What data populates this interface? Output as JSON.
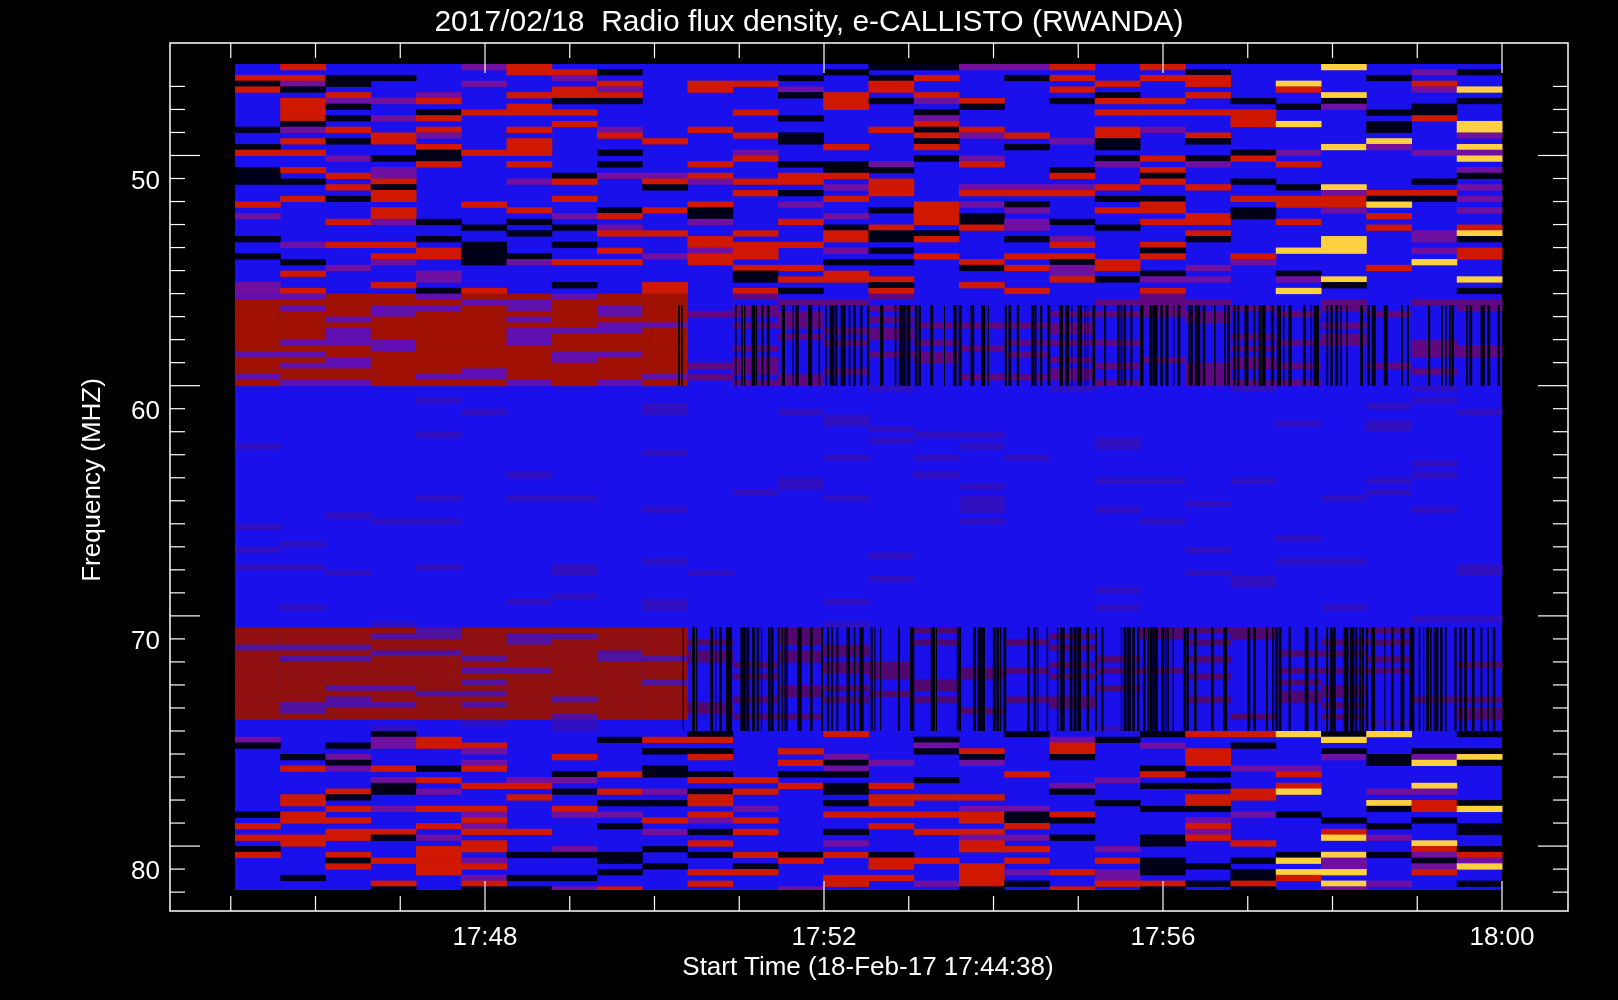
{
  "title": "2017/02/18  Radio flux density, e-CALLISTO (RWANDA)",
  "plot": {
    "ylabel": "Frequency (MHZ)",
    "xlabel": "Start Time (18-Feb-17 17:44:38)",
    "yticks": [
      "50",
      "60",
      "70",
      "80"
    ],
    "xticks": [
      "17:48",
      "17:52",
      "17:56",
      "18:00"
    ]
  }
}
